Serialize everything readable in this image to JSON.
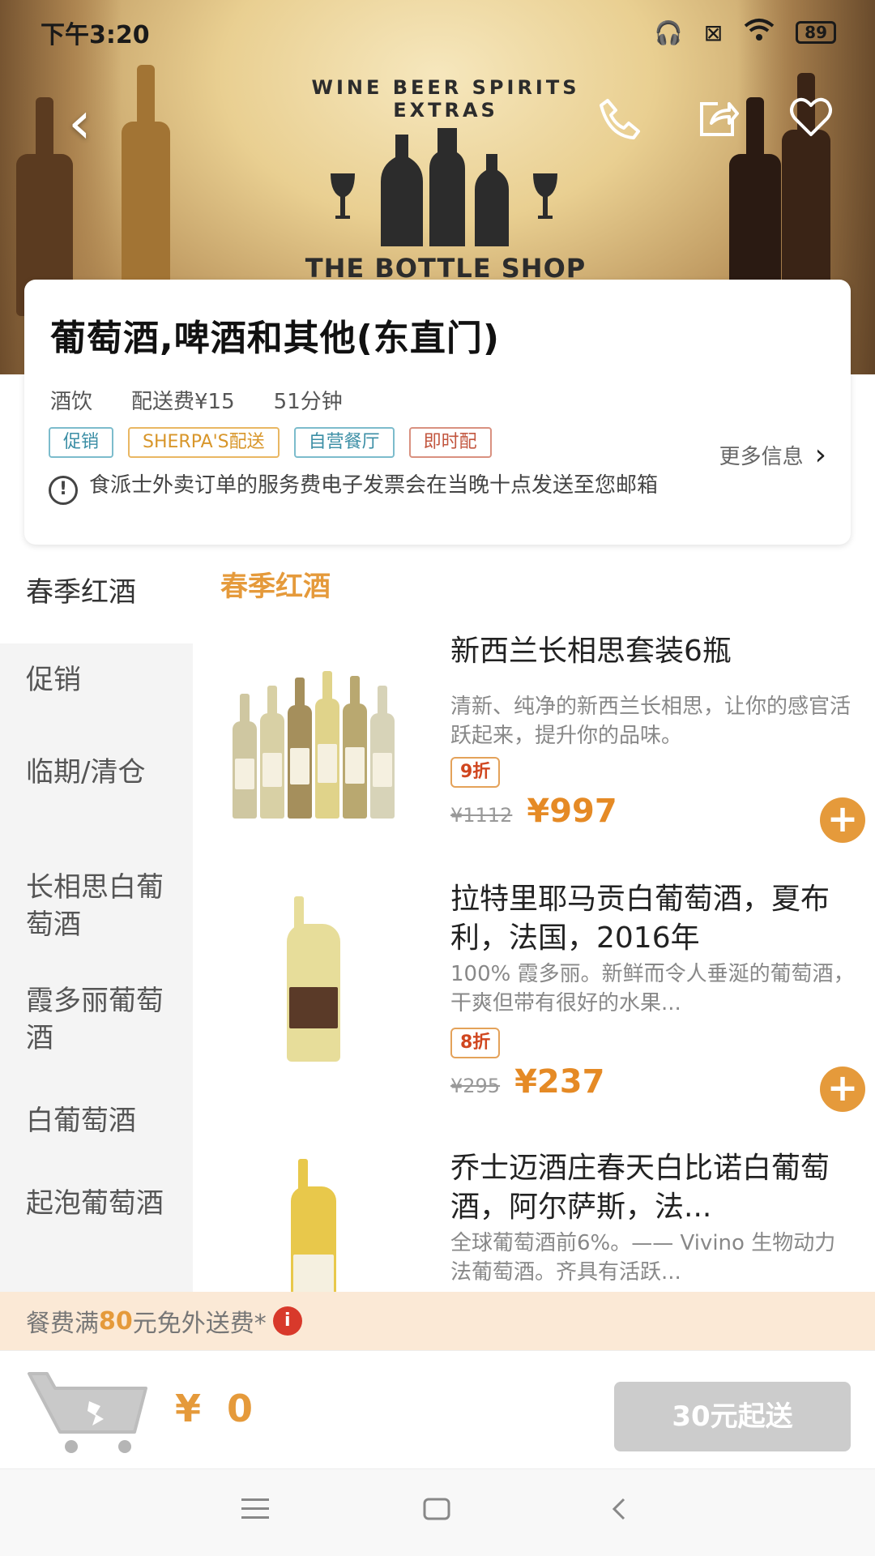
{
  "status_bar": {
    "time": "下午3:20",
    "battery": "89"
  },
  "hero": {
    "logo_arc_text": "WINE BEER SPIRITS EXTRAS",
    "logo_title": "THE BOTTLE SHOP"
  },
  "store": {
    "name": "葡萄酒,啤酒和其他(东直门)",
    "category": "酒饮",
    "delivery_fee": "配送费¥15",
    "delivery_time": "51分钟",
    "tags": [
      "促销",
      "SHERPA'S配送",
      "自营餐厅",
      "即时配"
    ],
    "more_info": "更多信息",
    "notice": "食派士外卖订单的服务费电子发票会在当晚十点发送至您邮箱"
  },
  "sidebar": {
    "items": [
      {
        "label": "春季红酒"
      },
      {
        "label": "促销"
      },
      {
        "label": "临期/清仓"
      },
      {
        "label": "长相思白葡萄酒"
      },
      {
        "label": "霞多丽葡萄酒"
      },
      {
        "label": "白葡萄酒"
      },
      {
        "label": "起泡葡萄酒"
      }
    ]
  },
  "section": {
    "title": "春季红酒"
  },
  "products": [
    {
      "name": "新西兰长相思套装6瓶",
      "desc": "清新、纯净的新西兰长相思，让你的感官活跃起来，提升你的品味。",
      "discount": "9折",
      "old_price": "¥1112",
      "price": "¥997"
    },
    {
      "name": "拉特里耶马贡白葡萄酒，夏布利，法国，2016年",
      "desc": "100% 霞多丽。新鲜而令人垂涎的葡萄酒，干爽但带有很好的水果...",
      "discount": "8折",
      "old_price": "¥295",
      "price": "¥237"
    },
    {
      "name": "乔士迈酒庄春天白比诺白葡萄酒，阿尔萨斯，法...",
      "desc": "全球葡萄酒前6%。—— Vivino 生物动力法葡萄酒。齐具有活跃..."
    }
  ],
  "free_delivery": {
    "prefix": "餐费满",
    "amount": "80",
    "suffix": "元免外送费*",
    "info_icon": "i"
  },
  "cart": {
    "total": "¥ 0",
    "min_order_label": "30元起送"
  },
  "colors": {
    "accent": "#e59a3b",
    "discount_red": "#d0461f",
    "teal_tag": "#3b8ea5"
  }
}
